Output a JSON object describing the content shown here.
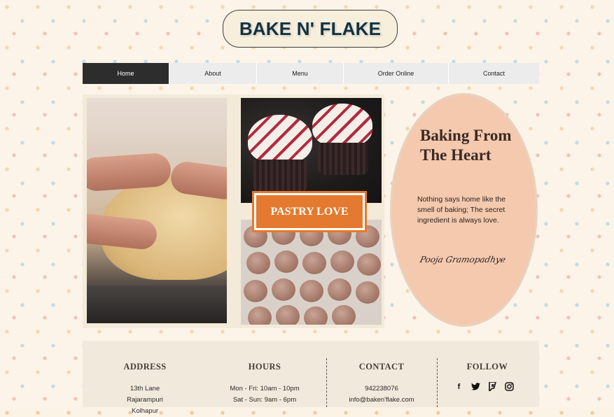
{
  "brand": {
    "logo_text": "BAKE N' FLAKE"
  },
  "nav": {
    "items": [
      {
        "label": "Home",
        "active": true
      },
      {
        "label": "About"
      },
      {
        "label": "Menu"
      },
      {
        "label": "Order Online"
      },
      {
        "label": "Contact"
      }
    ]
  },
  "hero": {
    "badge_label": "PASTRY LOVE",
    "title_line1": "Baking From",
    "title_line2": "The Heart",
    "tagline": "Nothing says home like the smell of baking; The secret ingredient is always love.",
    "signature": "Pooja Gramopadhye"
  },
  "footer": {
    "address": {
      "heading": "ADDRESS",
      "line1": "13th Lane",
      "line2": "Rajarampuri",
      "line3": "Kolhapur"
    },
    "hours": {
      "heading": "HOURS",
      "line1": "Mon - Fri: 10am - 10pm",
      "line2": "Sat - Sun: 9am - 6pm"
    },
    "contact": {
      "heading": "CONTACT",
      "phone": "942238076",
      "email": "info@baken'flake.com"
    },
    "follow": {
      "heading": "FOLLOW",
      "icons": [
        "facebook-icon",
        "twitter-icon",
        "foursquare-icon",
        "instagram-icon"
      ]
    }
  },
  "colors": {
    "accent_orange": "#e37a2f",
    "oval_peach": "#f4c9ad",
    "nav_active": "#2d2d2d",
    "logo_text": "#14323d"
  }
}
